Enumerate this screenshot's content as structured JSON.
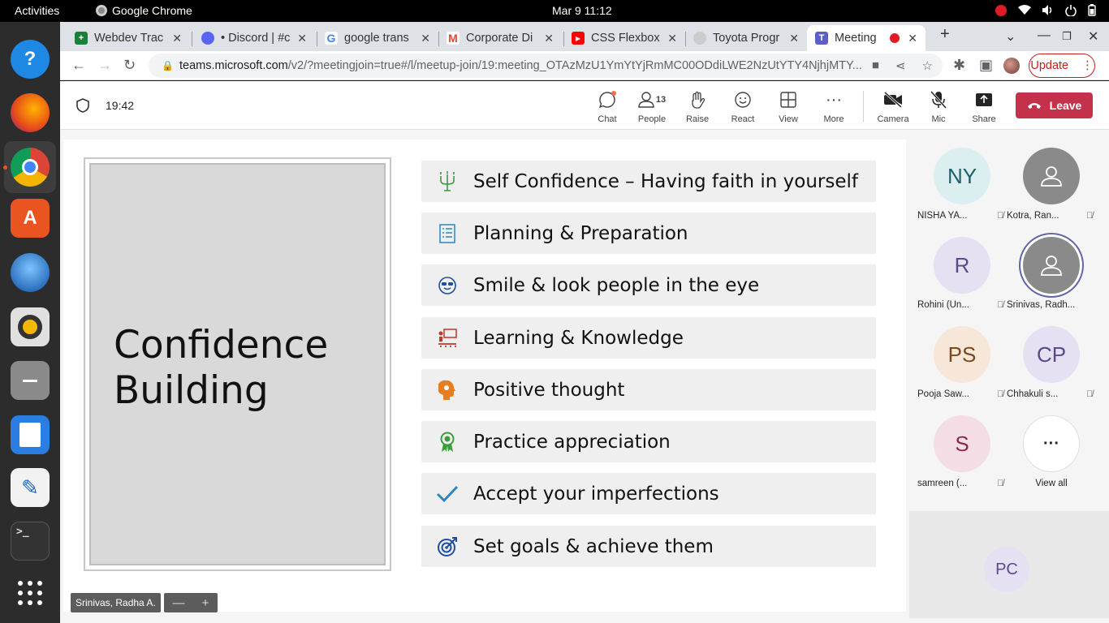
{
  "topbar": {
    "activities": "Activities",
    "app_name": "Google Chrome",
    "clock": "Mar 9  11:12"
  },
  "chrome": {
    "tabs": [
      {
        "title": "Webdev Trac",
        "favicon": "sheets-icon",
        "color": "#188038"
      },
      {
        "title": "• Discord | #c",
        "favicon": "discord-icon",
        "color": "#5865f2"
      },
      {
        "title": "google trans",
        "favicon": "google-icon",
        "color": "#4285f4"
      },
      {
        "title": "Corporate Di",
        "favicon": "gmail-icon",
        "color": "#ea4335"
      },
      {
        "title": "CSS Flexbox",
        "favicon": "youtube-icon",
        "color": "#ff0000"
      },
      {
        "title": "Toyota Progr",
        "favicon": "toyota-icon",
        "color": "#666666"
      },
      {
        "title": "Meeting",
        "favicon": "teams-icon",
        "color": "#5b5fc7"
      }
    ],
    "url_host": "teams.microsoft.com",
    "url_path": "/v2/?meetingjoin=true#/l/meetup-join/19:meeting_OTAzMzU1YmYtYjRmMC00ODdiLWE2NzUtYTY4NjhjMTY...",
    "update_label": "Update"
  },
  "callbar": {
    "timer": "19:42",
    "chat": "Chat",
    "people": "People",
    "people_count": "13",
    "raise": "Raise",
    "react": "React",
    "view": "View",
    "more": "More",
    "camera": "Camera",
    "mic": "Mic",
    "share": "Share",
    "leave": "Leave"
  },
  "slide": {
    "title_line1": "Confidence",
    "title_line2": "Building",
    "items": [
      {
        "text": "Self Confidence – Having faith in yourself",
        "icon": "candelabra-icon",
        "color": "#3a9e3a"
      },
      {
        "text": "Planning & Preparation",
        "icon": "checklist-icon",
        "color": "#2e86c1"
      },
      {
        "text": "Smile & look people in the eye",
        "icon": "smiley-sunglasses-icon",
        "color": "#1f4e9e"
      },
      {
        "text": "Learning & Knowledge",
        "icon": "classroom-icon",
        "color": "#c0392b"
      },
      {
        "text": "Positive thought",
        "icon": "head-gears-icon",
        "color": "#e67e22"
      },
      {
        "text": "Practice appreciation",
        "icon": "ribbon-award-icon",
        "color": "#3a9e3a"
      },
      {
        "text": "Accept your imperfections",
        "icon": "checkmark-icon",
        "color": "#2e86c1"
      },
      {
        "text": "Set goals & achieve them",
        "icon": "target-icon",
        "color": "#1f4e9e"
      }
    ]
  },
  "presenter": {
    "name": "Srinivas, Radha A.",
    "zoom_out": "—",
    "zoom_in": "+"
  },
  "participants": [
    {
      "initials": "NY",
      "name": "NISHA YA...",
      "bg": "#dbeef0",
      "fg": "#1f5f6b",
      "muted": true
    },
    {
      "initials": "",
      "name": "Kotra, Ran...",
      "bg": "#8a8a8a",
      "fg": "#ffffff",
      "muted": true
    },
    {
      "initials": "R",
      "name": "Rohini (Un...",
      "bg": "#e6e0f3",
      "fg": "#5b4a8b",
      "muted": true
    },
    {
      "initials": "",
      "name": "Srinivas, Radh...",
      "bg": "#8a8a8a",
      "fg": "#ffffff",
      "muted": false
    },
    {
      "initials": "PS",
      "name": "Pooja Saw...",
      "bg": "#f6e7d8",
      "fg": "#7a4b1a",
      "muted": true
    },
    {
      "initials": "CP",
      "name": "Chhakuli s...",
      "bg": "#e6e0f3",
      "fg": "#5b4a8b",
      "muted": true
    },
    {
      "initials": "S",
      "name": "samreen (...",
      "bg": "#f4dde4",
      "fg": "#8a2a4a",
      "muted": true
    },
    {
      "initials": "···",
      "name": "View all",
      "bg": "#ffffff",
      "fg": "#242424",
      "muted": false
    }
  ],
  "self": {
    "initials": "PC"
  }
}
